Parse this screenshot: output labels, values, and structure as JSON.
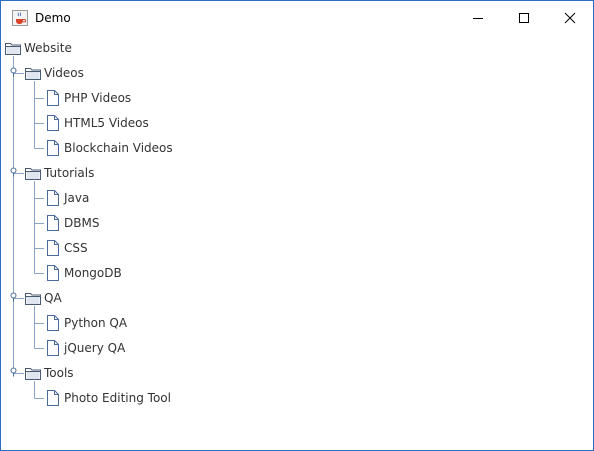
{
  "window": {
    "title": "Demo",
    "icon": "java-cup-icon",
    "controls": [
      "minimize-icon",
      "maximize-icon",
      "close-icon"
    ],
    "border_color": "#2b6cc4"
  },
  "tree": {
    "root": {
      "label": "Website",
      "icon": "folder-open-icon"
    },
    "groups": [
      {
        "label": "Videos",
        "icon": "folder-open-icon",
        "expanded": true,
        "children": [
          "PHP Videos",
          "HTML5 Videos",
          "Blockchain Videos"
        ]
      },
      {
        "label": "Tutorials",
        "icon": "folder-open-icon",
        "expanded": true,
        "children": [
          "Java",
          "DBMS",
          "CSS",
          "MongoDB"
        ]
      },
      {
        "label": "QA",
        "icon": "folder-open-icon",
        "expanded": true,
        "children": [
          "Python QA",
          "jQuery QA"
        ]
      },
      {
        "label": "Tools",
        "icon": "folder-open-icon",
        "expanded": true,
        "children": [
          "Photo Editing Tool"
        ]
      }
    ],
    "leaf_icon": "document-icon",
    "line_color": "#8aa4c8"
  }
}
